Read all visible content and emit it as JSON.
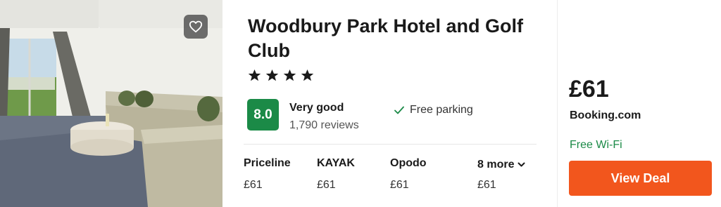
{
  "hotel": {
    "name": "Woodbury Park Hotel and Golf Club",
    "star_count": 4,
    "star_glyph": "★",
    "score": "8.0",
    "rating_label": "Very good",
    "review_count": "1,790 reviews",
    "amenity": "Free parking",
    "score_color": "#1b8a47"
  },
  "providers": [
    {
      "name": "Priceline",
      "price": "£61"
    },
    {
      "name": "KAYAK",
      "price": "£61"
    },
    {
      "name": "Opodo",
      "price": "£61"
    }
  ],
  "more": {
    "label": "8 more",
    "price": "£61"
  },
  "deal": {
    "price": "£61",
    "site": "Booking.com",
    "perk": "Free Wi-Fi",
    "button_label": "View Deal",
    "button_color": "#f2561d"
  },
  "icons": {
    "favorite": "heart-icon",
    "check": "checkmark-icon",
    "more": "chevron-down-icon"
  }
}
